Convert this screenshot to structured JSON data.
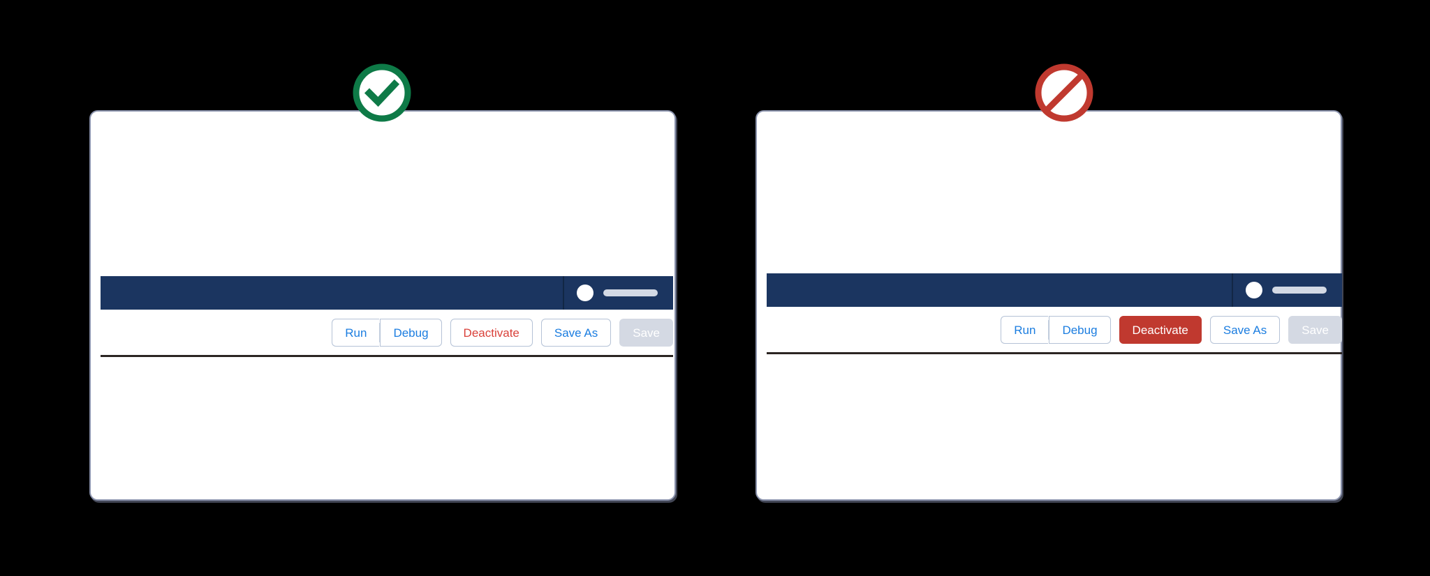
{
  "background_color": "#000000",
  "colors": {
    "panel_background": "#ffffff",
    "panel_border": "#8b93ad",
    "appbar_navy": "#1b3560",
    "link_blue": "#1b7de0",
    "danger_red": "#c0392f",
    "danger_text_red": "#d9413a",
    "disabled_gray": "#d4d9e3",
    "approved_green": "#0e7a47",
    "rejected_red": "#c0392f",
    "rule_dark": "#2b2522",
    "name_pill_gray": "#d3d9e4"
  },
  "examples": [
    {
      "id": "do",
      "status": {
        "icon": "check-circle-icon",
        "meaning": "approved",
        "color": "#0e7a47"
      },
      "appbar": {
        "avatar_icon": "user-avatar-icon",
        "name_placeholder_icon": "name-placeholder-bar"
      },
      "actions": {
        "group": [
          {
            "label": "Run",
            "style": "outline",
            "state": "enabled"
          },
          {
            "label": "Debug",
            "style": "outline",
            "state": "enabled"
          }
        ],
        "deactivate": {
          "label": "Deactivate",
          "style": "danger-outline",
          "state": "enabled"
        },
        "save_as": {
          "label": "Save As",
          "style": "outline",
          "state": "enabled"
        },
        "save": {
          "label": "Save",
          "style": "disabled",
          "state": "disabled"
        }
      }
    },
    {
      "id": "dont",
      "status": {
        "icon": "prohibited-icon",
        "meaning": "not-recommended",
        "color": "#c0392f"
      },
      "appbar": {
        "avatar_icon": "user-avatar-icon",
        "name_placeholder_icon": "name-placeholder-bar"
      },
      "actions": {
        "group": [
          {
            "label": "Run",
            "style": "outline",
            "state": "enabled"
          },
          {
            "label": "Debug",
            "style": "outline",
            "state": "enabled"
          }
        ],
        "deactivate": {
          "label": "Deactivate",
          "style": "danger-filled",
          "state": "enabled"
        },
        "save_as": {
          "label": "Save As",
          "style": "outline",
          "state": "enabled"
        },
        "save": {
          "label": "Save",
          "style": "disabled",
          "state": "disabled"
        }
      }
    }
  ]
}
